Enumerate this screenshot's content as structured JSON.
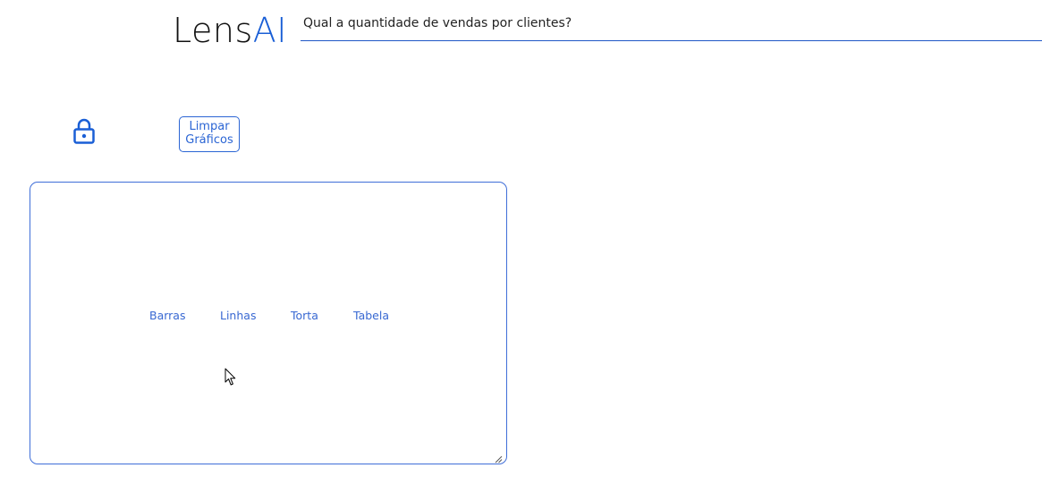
{
  "header": {
    "logo_text_main": "Lens",
    "logo_text_accent": "AI",
    "query_value": "Qual a quantidade de vendas por clientes?"
  },
  "controls": {
    "lock_icon": "lock-icon",
    "clear_line1": "Limpar",
    "clear_line2": "Gráficos"
  },
  "panel": {
    "chart_types": [
      "Barras",
      "Linhas",
      "Torta",
      "Tabela"
    ]
  },
  "colors": {
    "accent": "#2b65d4",
    "text": "#222222"
  }
}
